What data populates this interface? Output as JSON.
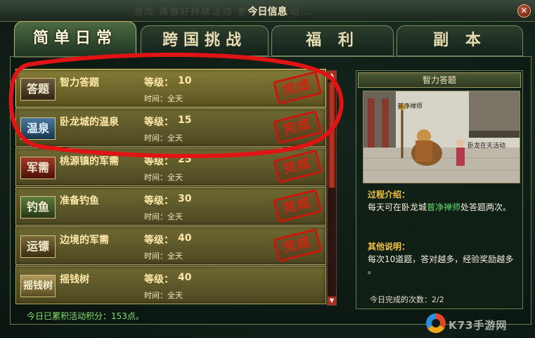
{
  "window": {
    "title": "今日信息",
    "bg_text": "游戏 请做好持续活动 参与官方活动...",
    "close_glyph": "✕"
  },
  "tabs": [
    {
      "label": "简单日常",
      "active": true
    },
    {
      "label": "跨国挑战",
      "active": false
    },
    {
      "label": "福 利",
      "active": false
    },
    {
      "label": "副 本",
      "active": false
    }
  ],
  "activities": [
    {
      "badge": "答题",
      "name": "智力答题",
      "level_label": "等级：",
      "level": "10",
      "time": "时间：全天",
      "status": "完成",
      "selected": true
    },
    {
      "badge": "温泉",
      "name": "卧龙城的温泉",
      "level_label": "等级：",
      "level": "15",
      "time": "时间：全天",
      "status": "完成",
      "selected": false
    },
    {
      "badge": "军需",
      "name": "桃源镇的军需",
      "level_label": "等级：",
      "level": "25",
      "time": "时间：全天",
      "status": "完成",
      "selected": false
    },
    {
      "badge": "钓鱼",
      "name": "准备钓鱼",
      "level_label": "等级：",
      "level": "30",
      "time": "时间：全天",
      "status": "完成",
      "selected": false
    },
    {
      "badge": "运镖",
      "name": "边境的军需",
      "level_label": "等级：",
      "level": "40",
      "time": "时间：全天",
      "status": "完成",
      "selected": false
    },
    {
      "badge": "摇钱树",
      "name": "摇钱树",
      "level_label": "等级：",
      "level": "40",
      "time": "时间：全天",
      "status": "",
      "selected": false
    }
  ],
  "footer": {
    "points_text": "今日已累积活动积分：153点。"
  },
  "detail": {
    "title": "智力答题",
    "preview_sign": "普净禅师",
    "preview_caption": "卧龙在天活动",
    "process_label": "过程介绍：",
    "process_pre": "每天可在卧龙城",
    "process_npc": "普净禅师",
    "process_post": "处答题两次。",
    "other_label": "其他说明：",
    "other_line1": "每次10道题，答对越多，经验奖励越多",
    "other_line2": "。",
    "count_text": "今日完成的次数：2/2"
  },
  "watermark": {
    "text": "K73手游网"
  },
  "colors": {
    "stamp_red": "#c8180e",
    "gold_text": "#ffe9a8",
    "green_text": "#7ee26a",
    "label_orange": "#f2c23c"
  }
}
